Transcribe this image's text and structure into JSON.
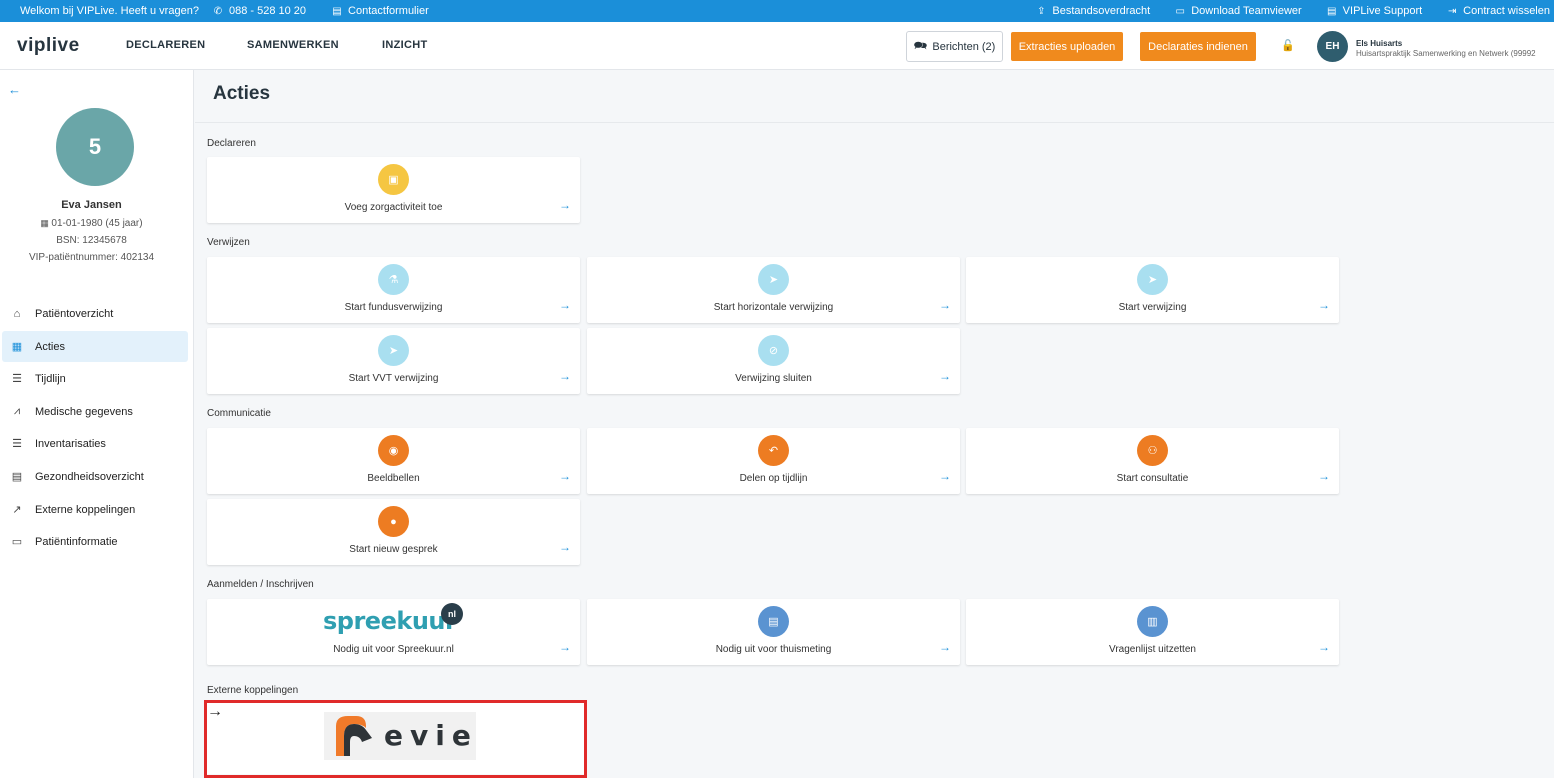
{
  "infobar": {
    "welcome": "Welkom bij VIPLive. Heeft u vragen?",
    "phone": "088 - 528 10 20",
    "contact": "Contactformulier",
    "links": [
      {
        "label": "Bestandsoverdracht",
        "icon": "upload-icon",
        "glyph": "⇪"
      },
      {
        "label": "Download Teamviewer",
        "icon": "monitor-icon",
        "glyph": "▭"
      },
      {
        "label": "VIPLive Support",
        "icon": "document-icon",
        "glyph": "▤"
      },
      {
        "label": "Contract wisselen",
        "icon": "switch-icon",
        "glyph": "⇥"
      }
    ]
  },
  "header": {
    "logo": "viplive",
    "nav": [
      "DECLAREREN",
      "SAMENWERKEN",
      "INZICHT"
    ],
    "messages_label": "Berichten (2)",
    "upload_label": "Extracties uploaden",
    "submit_label": "Declaraties indienen",
    "user_initials": "EH",
    "user_name": "Els Huisarts",
    "user_org": "Huisartspraktijk Samenwerking en Netwerk (99992"
  },
  "patient": {
    "number": "5",
    "name": "Eva Jansen",
    "birth": "01-01-1980  (45 jaar)",
    "bsn": "BSN: 12345678",
    "vip": "VIP-patiëntnummer: 402134"
  },
  "sidebar": {
    "items": [
      {
        "label": "Patiëntoverzicht",
        "icon": "home-icon"
      },
      {
        "label": "Acties",
        "icon": "calendar-icon"
      },
      {
        "label": "Tijdlijn",
        "icon": "list-icon"
      },
      {
        "label": "Medische gegevens",
        "icon": "chart-icon"
      },
      {
        "label": "Inventarisaties",
        "icon": "numbered-list-icon"
      },
      {
        "label": "Gezondheidsoverzicht",
        "icon": "document-icon"
      },
      {
        "label": "Externe koppelingen",
        "icon": "external-link-icon"
      },
      {
        "label": "Patiëntinformatie",
        "icon": "id-card-icon"
      }
    ]
  },
  "main": {
    "title": "Acties",
    "sections": {
      "declareren": "Declareren",
      "verwijzen": "Verwijzen",
      "communicatie": "Communicatie",
      "aanmelden": "Aanmelden / Inschrijven",
      "extern": "Externe koppelingen"
    },
    "cards": {
      "zorgactiviteit": "Voeg zorgactiviteit toe",
      "fundus": "Start fundusverwijzing",
      "horizontaal": "Start horizontale verwijzing",
      "verwijzing": "Start verwijzing",
      "vvt": "Start VVT verwijzing",
      "sluiten": "Verwijzing sluiten",
      "beeldbellen": "Beeldbellen",
      "delen": "Delen op tijdlijn",
      "consultatie": "Start consultatie",
      "gesprek": "Start nieuw gesprek",
      "spreekuur": "Nodig uit voor Spreekuur.nl",
      "thuismeting": "Nodig uit voor thuismeting",
      "vragenlijst": "Vragenlijst uitzetten"
    },
    "spreekuur_logo": "spreekuur",
    "spreekuur_logo_badge": "nl",
    "evie_logo": "evie"
  },
  "colors": {
    "accent": "#1b8fd9",
    "orange": "#f08a1d",
    "highlight": "#e02a2a"
  }
}
